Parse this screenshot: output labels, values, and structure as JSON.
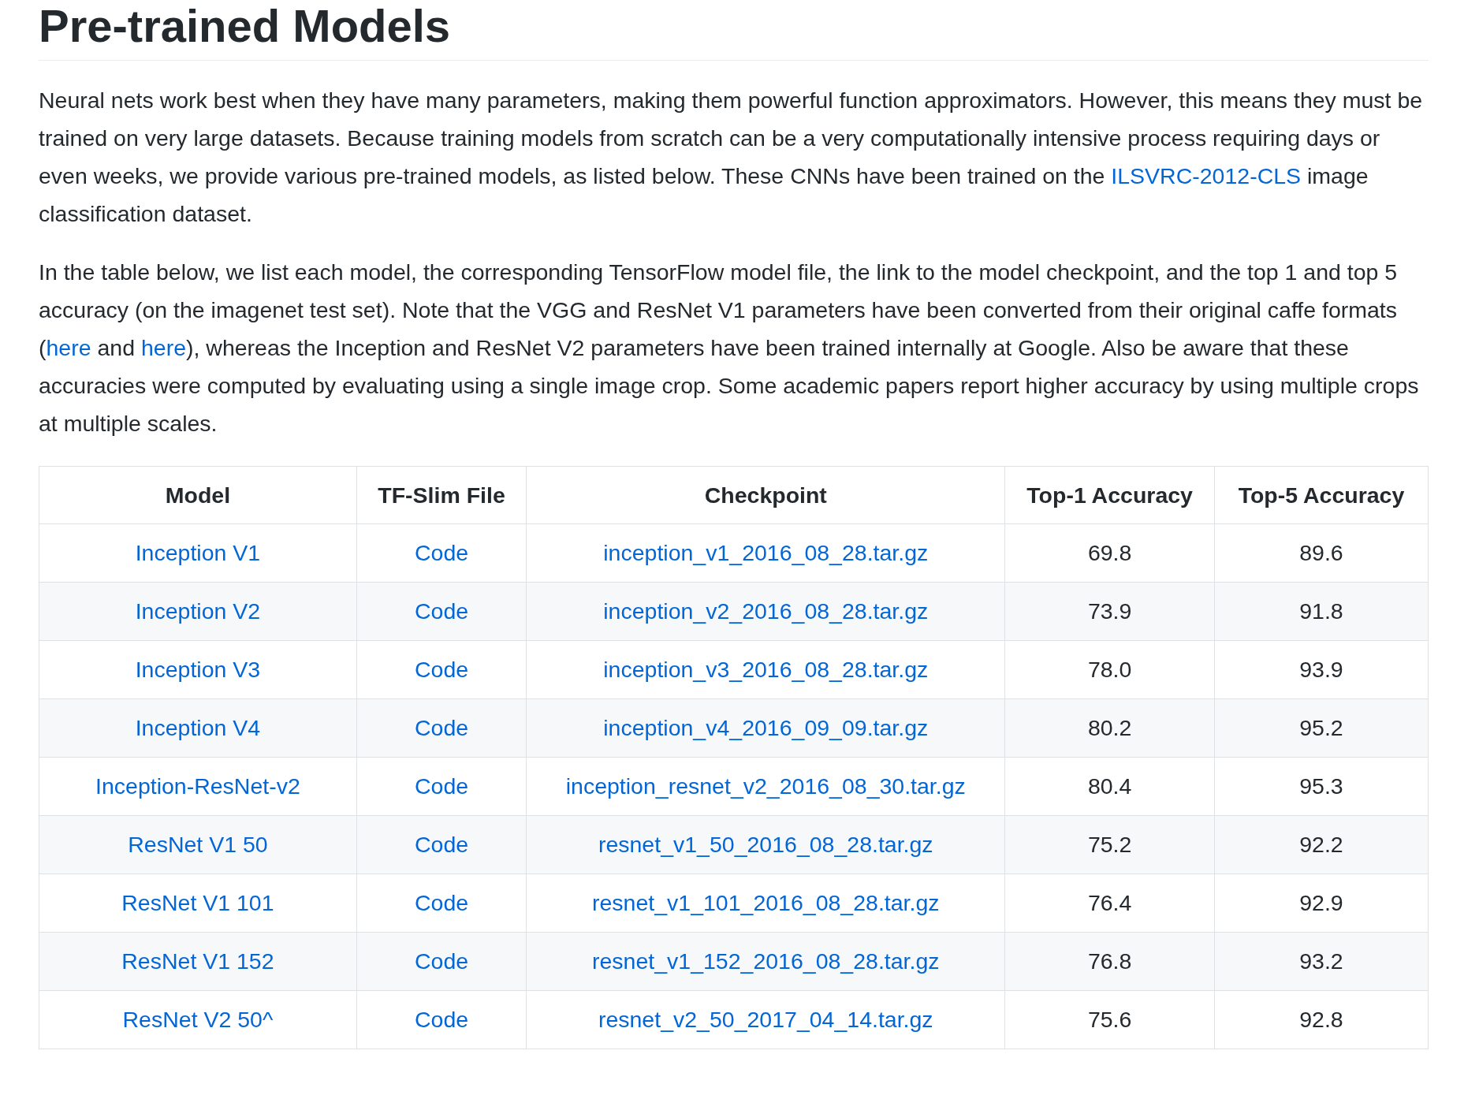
{
  "heading": "Pre-trained Models",
  "paragraphs": [
    [
      {
        "kind": "text",
        "text": "Neural nets work best when they have many parameters, making them powerful function approximators. However, this means they must be trained on very large datasets. Because training models from scratch can be a very computationally intensive process requiring days or even weeks, we provide various pre-trained models, as listed below. These CNNs have been trained on the "
      },
      {
        "kind": "link",
        "text": "ILSVRC-2012-CLS"
      },
      {
        "kind": "text",
        "text": " image classification dataset."
      }
    ],
    [
      {
        "kind": "text",
        "text": "In the table below, we list each model, the corresponding TensorFlow model file, the link to the model checkpoint, and the top 1 and top 5 accuracy (on the imagenet test set). Note that the VGG and ResNet V1 parameters have been converted from their original caffe formats ("
      },
      {
        "kind": "link",
        "text": "here"
      },
      {
        "kind": "text",
        "text": " and "
      },
      {
        "kind": "link",
        "text": "here"
      },
      {
        "kind": "text",
        "text": "), whereas the Inception and ResNet V2 parameters have been trained internally at Google. Also be aware that these accuracies were computed by evaluating using a single image crop. Some academic papers report higher accuracy by using multiple crops at multiple scales."
      }
    ]
  ],
  "table": {
    "columns": [
      "Model",
      "TF-Slim File",
      "Checkpoint",
      "Top-1 Accuracy",
      "Top-5 Accuracy"
    ],
    "rows": [
      [
        "Inception V1",
        "Code",
        "inception_v1_2016_08_28.tar.gz",
        "69.8",
        "89.6"
      ],
      [
        "Inception V2",
        "Code",
        "inception_v2_2016_08_28.tar.gz",
        "73.9",
        "91.8"
      ],
      [
        "Inception V3",
        "Code",
        "inception_v3_2016_08_28.tar.gz",
        "78.0",
        "93.9"
      ],
      [
        "Inception V4",
        "Code",
        "inception_v4_2016_09_09.tar.gz",
        "80.2",
        "95.2"
      ],
      [
        "Inception-ResNet-v2",
        "Code",
        "inception_resnet_v2_2016_08_30.tar.gz",
        "80.4",
        "95.3"
      ],
      [
        "ResNet V1 50",
        "Code",
        "resnet_v1_50_2016_08_28.tar.gz",
        "75.2",
        "92.2"
      ],
      [
        "ResNet V1 101",
        "Code",
        "resnet_v1_101_2016_08_28.tar.gz",
        "76.4",
        "92.9"
      ],
      [
        "ResNet V1 152",
        "Code",
        "resnet_v1_152_2016_08_28.tar.gz",
        "76.8",
        "93.2"
      ],
      [
        "ResNet V2 50^",
        "Code",
        "resnet_v2_50_2017_04_14.tar.gz",
        "75.6",
        "92.8"
      ]
    ]
  }
}
